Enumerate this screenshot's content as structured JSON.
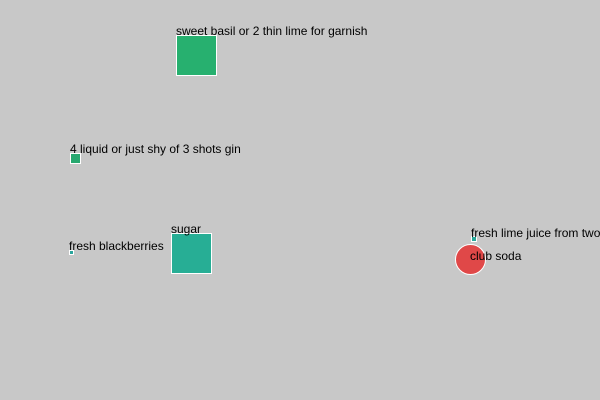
{
  "background_color": "#c8c8c8",
  "items": [
    {
      "label": "sweet basil or 2 thin lime for garnish",
      "shape": "square",
      "color": "#27b06f"
    },
    {
      "label": "4 liquid or just shy of 3 shots gin",
      "shape": "square",
      "color": "#27a86f"
    },
    {
      "label": "sugar",
      "shape": "square",
      "color": "#27ae95"
    },
    {
      "label": "fresh blackberries",
      "shape": "square",
      "color": "#2aa59c"
    },
    {
      "label": "fresh lime juice from two",
      "shape": "square",
      "color": "#28a89a"
    },
    {
      "label": "club soda",
      "shape": "circle",
      "color": "#e04848"
    }
  ]
}
